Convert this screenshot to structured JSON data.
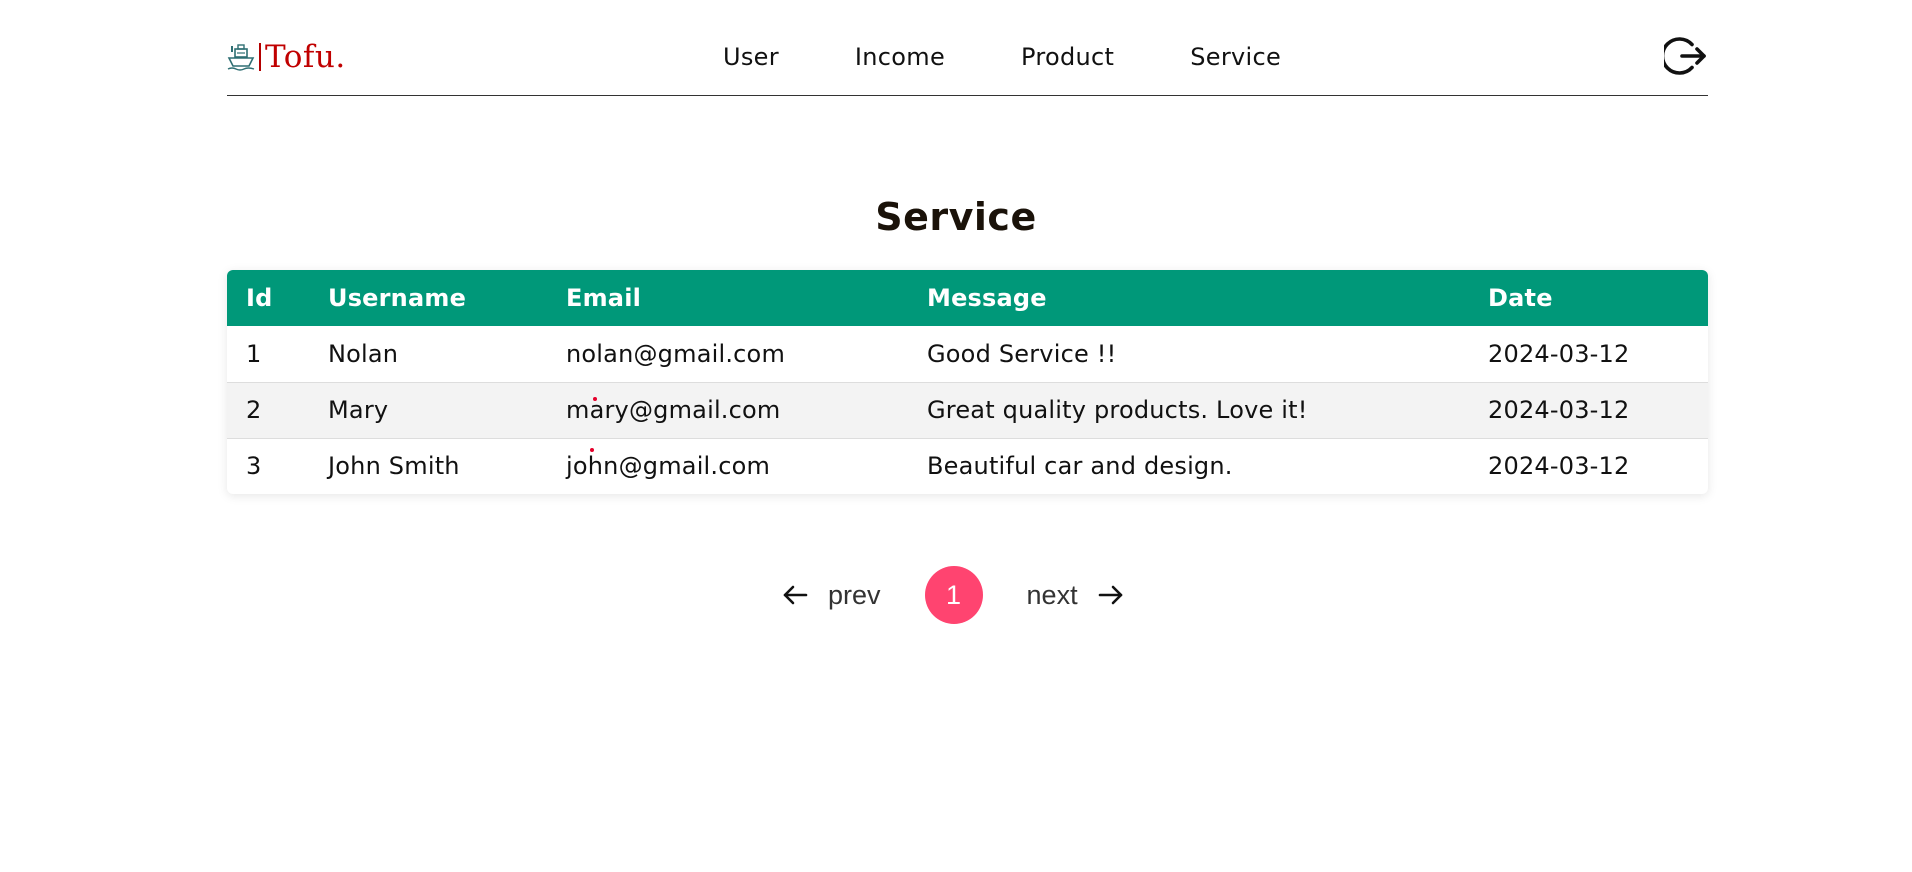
{
  "app": {
    "logo_text": "Tofu.",
    "brand_color": "#c00000"
  },
  "nav": {
    "items": [
      {
        "label": "User"
      },
      {
        "label": "Income"
      },
      {
        "label": "Product"
      },
      {
        "label": "Service"
      }
    ],
    "logout_icon": "logout-icon"
  },
  "page": {
    "title": "Service"
  },
  "table": {
    "header_color": "#009879",
    "columns": [
      "Id",
      "Username",
      "Email",
      "Message",
      "Date"
    ],
    "rows": [
      {
        "id": "1",
        "username": "Nolan",
        "email": "nolan@gmail.com",
        "message": "Good Service !!",
        "date": "2024-03-12"
      },
      {
        "id": "2",
        "username": "Mary",
        "email": "mary@gmail.com",
        "message": "Great quality products. Love it!",
        "date": "2024-03-12"
      },
      {
        "id": "3",
        "username": "John Smith",
        "email": "john@gmail.com",
        "message": "Beautiful car and design.",
        "date": "2024-03-12"
      }
    ]
  },
  "pagination": {
    "prev_label": "prev",
    "next_label": "next",
    "current_page": "1",
    "accent_color": "#ff4470"
  }
}
